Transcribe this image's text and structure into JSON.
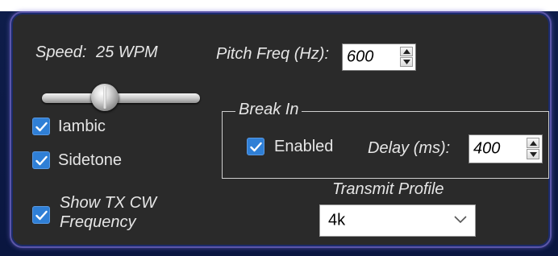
{
  "panel": {
    "speed": {
      "label": "Speed:",
      "value": "25 WPM"
    },
    "iambic": {
      "label": "Iambic",
      "checked": true
    },
    "sidetone": {
      "label": "Sidetone",
      "checked": true
    },
    "show_tx_cw": {
      "label_line1": "Show TX CW",
      "label_line2": "Frequency",
      "checked": true
    },
    "pitch": {
      "label": "Pitch Freq (Hz):",
      "value": "600"
    },
    "break_in": {
      "title": "Break In",
      "enabled": {
        "label": "Enabled",
        "checked": true
      },
      "delay": {
        "label": "Delay (ms):",
        "value": "400"
      }
    },
    "transmit_profile": {
      "label": "Transmit Profile",
      "selected": "4k"
    }
  },
  "colors": {
    "panel_bg": "#2a2a2a",
    "panel_border": "#5b55a8",
    "checkbox": "#2f7fd6",
    "text": "#e6e6e6",
    "outer_bg": "#0e1d4a"
  },
  "icons": [
    "checkmark-icon",
    "arrow-up-icon",
    "arrow-down-icon",
    "chevron-down-icon"
  ]
}
